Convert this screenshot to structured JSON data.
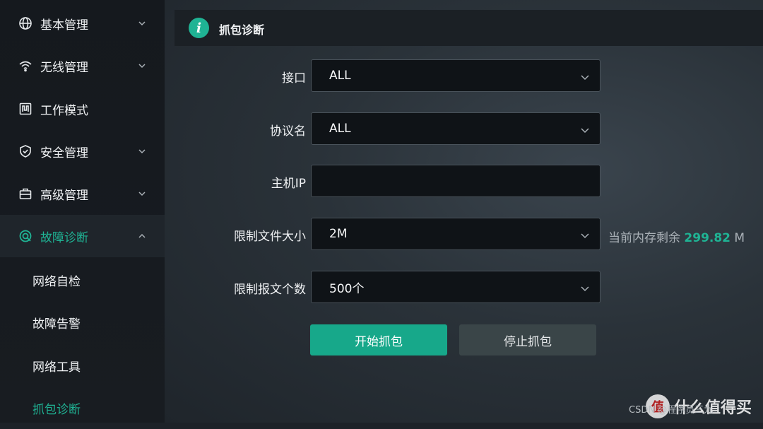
{
  "sidebar": {
    "items": [
      {
        "label": "基本管理",
        "icon": "globe-icon",
        "expandable": true,
        "expanded": false
      },
      {
        "label": "无线管理",
        "icon": "wifi-icon",
        "expandable": true,
        "expanded": false
      },
      {
        "label": "工作模式",
        "icon": "mode-icon",
        "expandable": false
      },
      {
        "label": "安全管理",
        "icon": "shield-icon",
        "expandable": true,
        "expanded": false
      },
      {
        "label": "高级管理",
        "icon": "toolbox-icon",
        "expandable": true,
        "expanded": false
      },
      {
        "label": "故障诊断",
        "icon": "diagnosis-icon",
        "expandable": true,
        "expanded": true,
        "active": true
      }
    ],
    "subitems": [
      {
        "label": "网络自检"
      },
      {
        "label": "故障告警"
      },
      {
        "label": "网络工具"
      },
      {
        "label": "抓包诊断",
        "active": true
      }
    ]
  },
  "header": {
    "title": "抓包诊断",
    "icon": "info-icon",
    "icon_glyph": "i"
  },
  "form": {
    "interface": {
      "label": "接口",
      "value": "ALL"
    },
    "protocol": {
      "label": "协议名",
      "value": "ALL"
    },
    "host_ip": {
      "label": "主机IP",
      "value": ""
    },
    "file_size": {
      "label": "限制文件大小",
      "value": "2M"
    },
    "packet_count": {
      "label": "限制报文个数",
      "value": "500个"
    },
    "memory": {
      "prefix": "当前内存剩余",
      "value": "299.82",
      "unit": "M"
    }
  },
  "buttons": {
    "start": "开始抓包",
    "stop": "停止抓包"
  },
  "watermark": {
    "small": "CSDN @程序员三九",
    "logo": "值",
    "text": "什么值得买"
  },
  "colors": {
    "accent": "#1fb394",
    "button_primary": "#17a88a",
    "button_secondary": "#3a4548"
  }
}
